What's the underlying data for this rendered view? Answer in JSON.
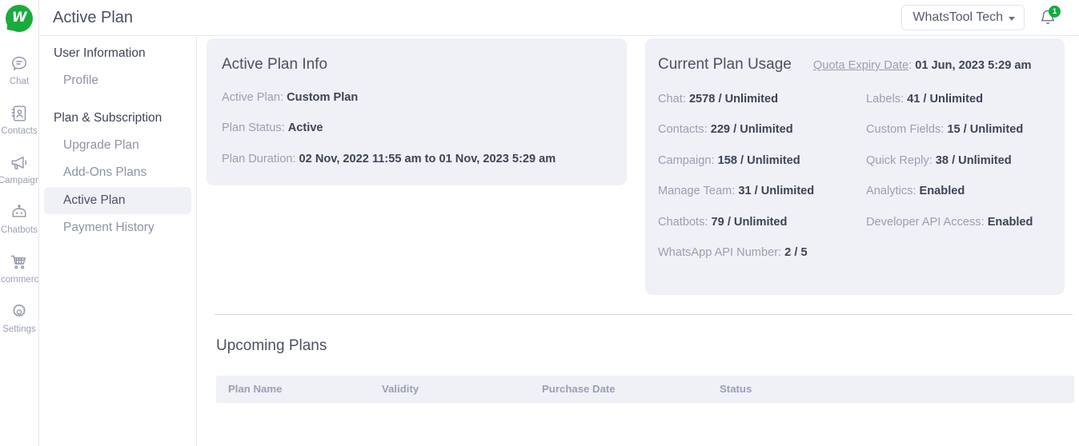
{
  "brand": {
    "logo_letter": "W",
    "logo_color": "#1aab3d"
  },
  "header": {
    "title": "Active Plan",
    "org_name": "WhatsTool Tech",
    "notification_count": "1",
    "bell_badge_color": "#10ad3f"
  },
  "rail": {
    "items": [
      {
        "label": "Chat",
        "icon": "chat-icon"
      },
      {
        "label": "Contacts",
        "icon": "contacts-icon"
      },
      {
        "label": "Campaign",
        "icon": "campaign-icon"
      },
      {
        "label": "Chatbots",
        "icon": "chatbots-icon"
      },
      {
        "label": "Ecommerce",
        "icon": "ecommerce-icon"
      },
      {
        "label": "Settings",
        "icon": "settings-icon"
      }
    ]
  },
  "sidebar": {
    "group1_title": "User Information",
    "group1_items": [
      {
        "label": "Profile",
        "active": false
      }
    ],
    "group2_title": "Plan & Subscription",
    "group2_items": [
      {
        "label": "Upgrade Plan",
        "active": false
      },
      {
        "label": "Add-Ons Plans",
        "active": false
      },
      {
        "label": "Active Plan",
        "active": true
      },
      {
        "label": "Payment History",
        "active": false
      }
    ]
  },
  "active_plan_info": {
    "title": "Active Plan Info",
    "rows": [
      {
        "label": "Active Plan: ",
        "value": "Custom Plan"
      },
      {
        "label": "Plan Status: ",
        "value": "Active"
      },
      {
        "label": "Plan Duration: ",
        "value": "02 Nov, 2022 11:55 am to 01 Nov, 2023 5:29 am"
      }
    ]
  },
  "current_plan_usage": {
    "title": "Current Plan Usage",
    "quota_label": "Quota Expiry Date",
    "quota_sep": ": ",
    "quota_value": "01 Jun, 2023 5:29 am",
    "column_left": [
      {
        "label": "Chat: ",
        "value": "2578 / Unlimited"
      },
      {
        "label": "Contacts: ",
        "value": "229 / Unlimited"
      },
      {
        "label": "Campaign: ",
        "value": "158 / Unlimited"
      },
      {
        "label": "Manage Team: ",
        "value": "31 / Unlimited"
      },
      {
        "label": "Chatbots: ",
        "value": "79 / Unlimited"
      },
      {
        "label": "WhatsApp API Number: ",
        "value": "2 / 5"
      }
    ],
    "column_right": [
      {
        "label": "Labels: ",
        "value": "41 / Unlimited"
      },
      {
        "label": "Custom Fields: ",
        "value": "15 / Unlimited"
      },
      {
        "label": "Quick Reply: ",
        "value": "38 / Unlimited"
      },
      {
        "label": "Analytics: ",
        "value": "Enabled"
      },
      {
        "label": "Developer API Access: ",
        "value": "Enabled"
      }
    ]
  },
  "upcoming_plans": {
    "title": "Upcoming Plans",
    "columns": [
      "Plan Name",
      "Validity",
      "Purchase Date",
      "Status"
    ],
    "rows": []
  }
}
